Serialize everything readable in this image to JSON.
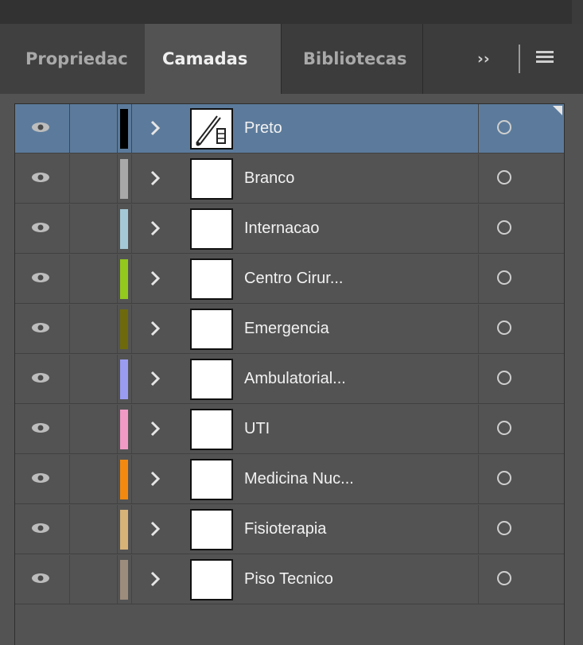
{
  "tabs": [
    {
      "label": "Propriedac"
    },
    {
      "label": "Camadas"
    },
    {
      "label": "Bibliotecas"
    }
  ],
  "overflow_label": "››",
  "colors": {
    "selected_row": "#5c7b9c",
    "panel_bg": "#535353"
  },
  "layers": [
    {
      "name": "Preto",
      "color": "#000000",
      "selected": true,
      "icon": "pen-drawing-thumbnail"
    },
    {
      "name": "Branco",
      "color": "#a8a8a8"
    },
    {
      "name": "Internacao",
      "color": "#a5c8d6"
    },
    {
      "name": "Centro Cirur...",
      "color": "#93c81c"
    },
    {
      "name": "Emergencia",
      "color": "#6e6a0c"
    },
    {
      "name": "Ambulatorial...",
      "color": "#9a9cf2"
    },
    {
      "name": "UTI",
      "color": "#f19ac6"
    },
    {
      "name": "Medicina Nuc...",
      "color": "#f38a0f"
    },
    {
      "name": "Fisioterapia",
      "color": "#d7b378"
    },
    {
      "name": "Piso Tecnico",
      "color": "#9c8c7c"
    }
  ]
}
